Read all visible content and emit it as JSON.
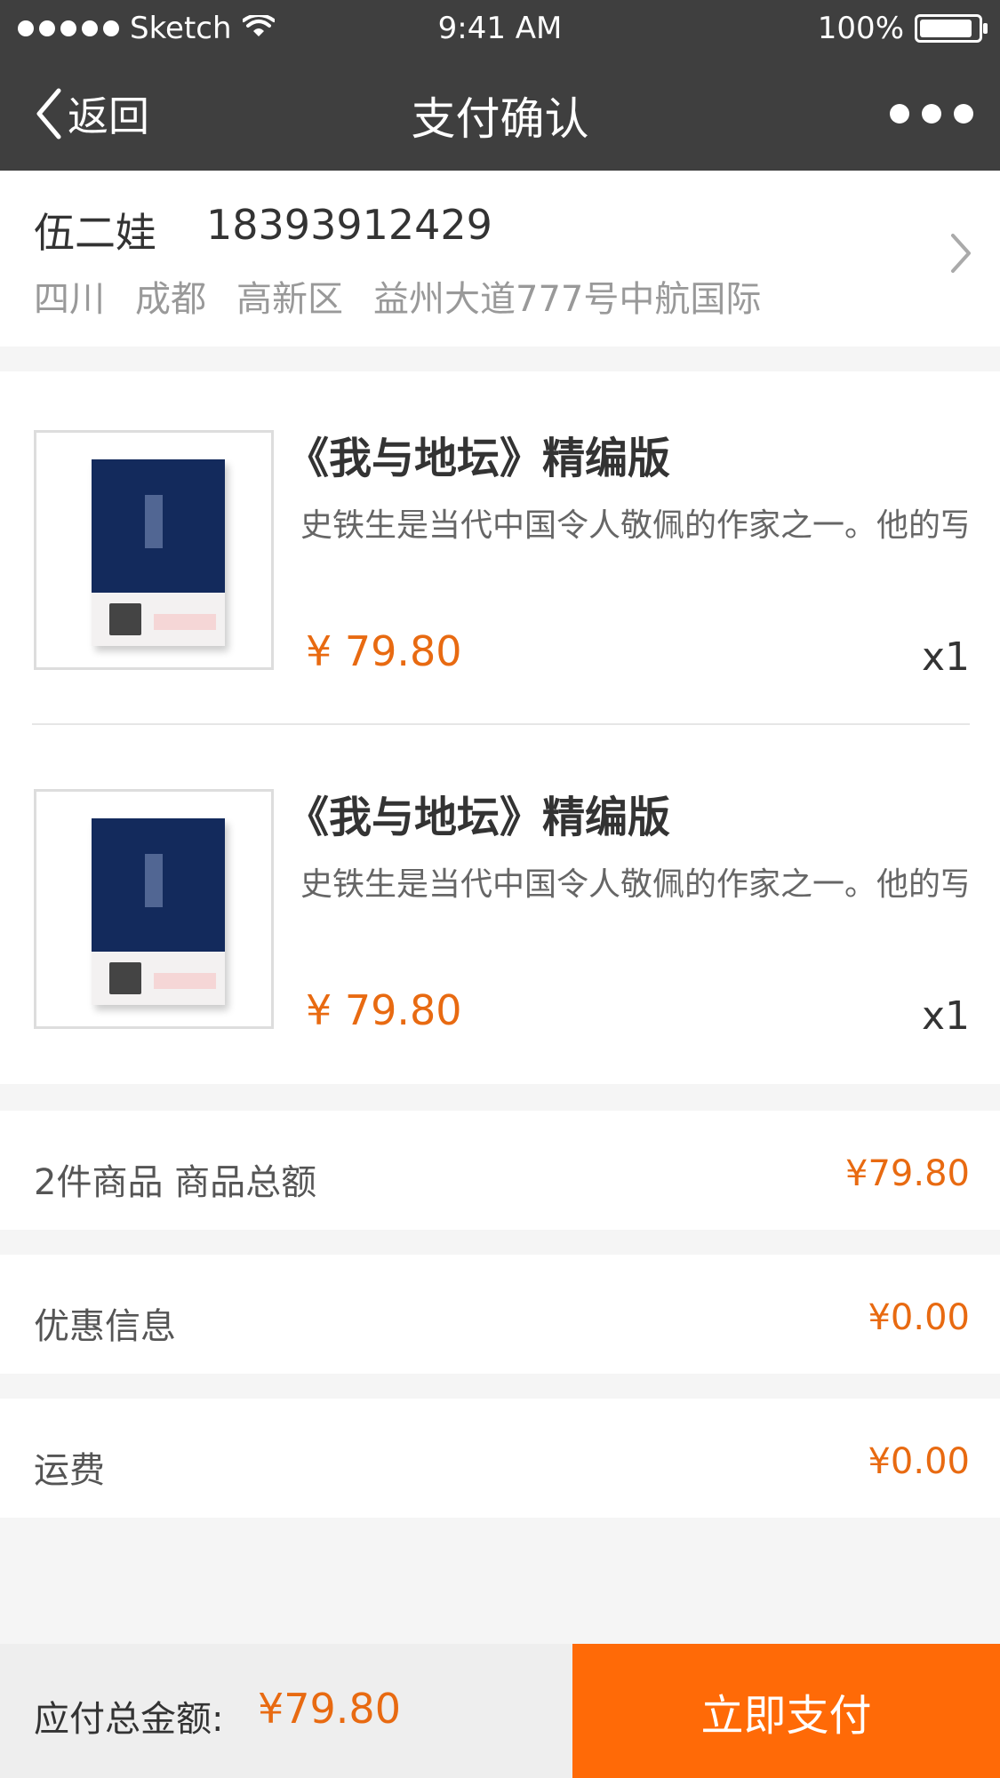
{
  "status_bar": {
    "carrier": "Sketch",
    "time": "9:41 AM",
    "battery": "100%"
  },
  "nav": {
    "back_label": "返回",
    "title": "支付确认"
  },
  "address": {
    "name": "伍二娃",
    "phone": "18393912429",
    "province": "四川",
    "city": "成都",
    "district": "高新区",
    "street": "益州大道777号中航国际"
  },
  "items": [
    {
      "title": "《我与地坛》精编版",
      "description": "史铁生是当代中国令人敬佩的作家之一。他的写",
      "price": "¥ 79.80",
      "quantity": "x1"
    },
    {
      "title": "《我与地坛》精编版",
      "description": "史铁生是当代中国令人敬佩的作家之一。他的写",
      "price": "¥ 79.80",
      "quantity": "x1"
    }
  ],
  "summary": {
    "goods_total_label": "2件商品  商品总额",
    "goods_total_value": "¥79.80",
    "discount_label": "优惠信息",
    "discount_value": "¥0.00",
    "shipping_label": "运费",
    "shipping_value": "¥0.00"
  },
  "bottom": {
    "total_label": "应付总金额:",
    "total_value": "¥79.80",
    "pay_button": "立即支付"
  },
  "colors": {
    "nav_bg": "#3f3f3f",
    "accent_orange": "#ff6a07",
    "price_orange": "#e86a11",
    "page_bg": "#f5f5f5"
  },
  "icons": {
    "back": "chevron-left-icon",
    "more": "more-dots-icon",
    "address_arrow": "chevron-right-icon",
    "wifi": "wifi-icon",
    "signal": "signal-dots-icon",
    "battery": "battery-icon"
  }
}
